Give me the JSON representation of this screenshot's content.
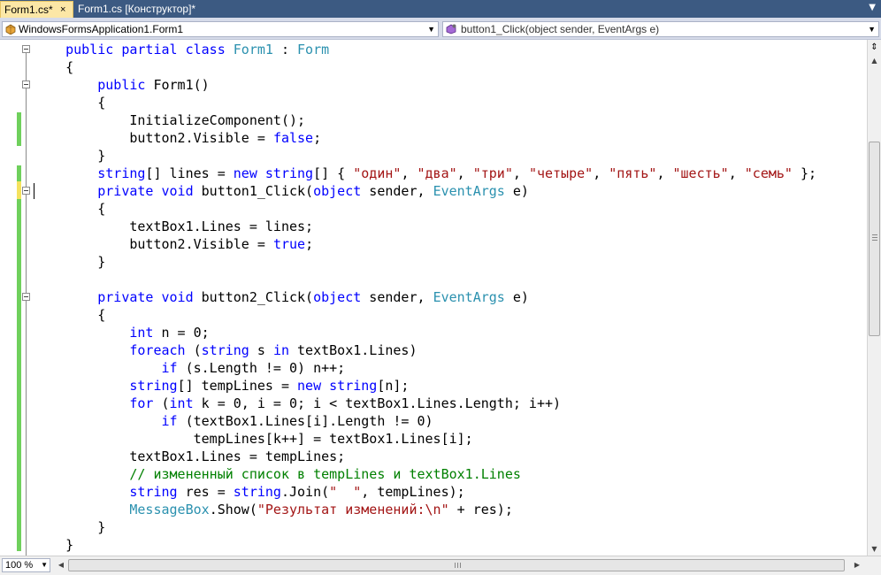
{
  "tabs": [
    {
      "label": "Form1.cs*",
      "active": true
    },
    {
      "label": "Form1.cs [Конструктор]*",
      "active": false
    }
  ],
  "tab_close_glyph": "×",
  "navigation": {
    "class_combo": "WindowsFormsApplication1.Form1",
    "member_combo": "button1_Click(object sender, EventArgs e)"
  },
  "zoom": "100 %",
  "colors": {
    "keyword": "#0000ff",
    "type": "#2b91af",
    "string": "#a31515",
    "comment": "#008000",
    "changed_saved": "#6fd05c",
    "changed_unsaved": "#f5e25e",
    "tabbar_background": "#3c5a82",
    "active_tab": "#fce7a6"
  },
  "code_lines": [
    [
      [
        "",
        "    "
      ],
      [
        "kw",
        "public partial class"
      ],
      [
        "",
        " "
      ],
      [
        "ty",
        "Form1"
      ],
      [
        "",
        " : "
      ],
      [
        "ty",
        "Form"
      ]
    ],
    [
      [
        "",
        "    {"
      ]
    ],
    [
      [
        "",
        "        "
      ],
      [
        "kw",
        "public"
      ],
      [
        "",
        " Form1()"
      ]
    ],
    [
      [
        "",
        "        {"
      ]
    ],
    [
      [
        "",
        "            InitializeComponent();"
      ]
    ],
    [
      [
        "",
        "            button2.Visible = "
      ],
      [
        "kw",
        "false"
      ],
      [
        "",
        ";"
      ]
    ],
    [
      [
        "",
        "        }"
      ]
    ],
    [
      [
        "",
        "        "
      ],
      [
        "kw",
        "string"
      ],
      [
        "",
        "[] lines = "
      ],
      [
        "kw",
        "new"
      ],
      [
        "",
        " "
      ],
      [
        "kw",
        "string"
      ],
      [
        "",
        "[] { "
      ],
      [
        "st",
        "\"один\""
      ],
      [
        "",
        ", "
      ],
      [
        "st",
        "\"два\""
      ],
      [
        "",
        ", "
      ],
      [
        "st",
        "\"три\""
      ],
      [
        "",
        ", "
      ],
      [
        "st",
        "\"четыре\""
      ],
      [
        "",
        ", "
      ],
      [
        "st",
        "\"пять\""
      ],
      [
        "",
        ", "
      ],
      [
        "st",
        "\"шесть\""
      ],
      [
        "",
        ", "
      ],
      [
        "st",
        "\"семь\""
      ],
      [
        "",
        " };"
      ]
    ],
    [
      [
        "",
        "        "
      ],
      [
        "kw",
        "private void"
      ],
      [
        "",
        " button1_Click("
      ],
      [
        "kw",
        "object"
      ],
      [
        "",
        " sender, "
      ],
      [
        "ty",
        "EventArgs"
      ],
      [
        "",
        " e)"
      ]
    ],
    [
      [
        "",
        "        {"
      ]
    ],
    [
      [
        "",
        "            textBox1.Lines = lines;"
      ]
    ],
    [
      [
        "",
        "            button2.Visible = "
      ],
      [
        "kw",
        "true"
      ],
      [
        "",
        ";"
      ]
    ],
    [
      [
        "",
        "        }"
      ]
    ],
    [
      [
        "",
        ""
      ]
    ],
    [
      [
        "",
        "        "
      ],
      [
        "kw",
        "private void"
      ],
      [
        "",
        " button2_Click("
      ],
      [
        "kw",
        "object"
      ],
      [
        "",
        " sender, "
      ],
      [
        "ty",
        "EventArgs"
      ],
      [
        "",
        " e)"
      ]
    ],
    [
      [
        "",
        "        {"
      ]
    ],
    [
      [
        "",
        "            "
      ],
      [
        "kw",
        "int"
      ],
      [
        "",
        " n = 0;"
      ]
    ],
    [
      [
        "",
        "            "
      ],
      [
        "kw",
        "foreach"
      ],
      [
        "",
        " ("
      ],
      [
        "kw",
        "string"
      ],
      [
        "",
        " s "
      ],
      [
        "kw",
        "in"
      ],
      [
        "",
        " textBox1.Lines)"
      ]
    ],
    [
      [
        "",
        "                "
      ],
      [
        "kw",
        "if"
      ],
      [
        "",
        " (s.Length != 0) n++;"
      ]
    ],
    [
      [
        "",
        "            "
      ],
      [
        "kw",
        "string"
      ],
      [
        "",
        "[] tempLines = "
      ],
      [
        "kw",
        "new"
      ],
      [
        "",
        " "
      ],
      [
        "kw",
        "string"
      ],
      [
        "",
        "[n];"
      ]
    ],
    [
      [
        "",
        "            "
      ],
      [
        "kw",
        "for"
      ],
      [
        "",
        " ("
      ],
      [
        "kw",
        "int"
      ],
      [
        "",
        " k = 0, i = 0; i < textBox1.Lines.Length; i++)"
      ]
    ],
    [
      [
        "",
        "                "
      ],
      [
        "kw",
        "if"
      ],
      [
        "",
        " (textBox1.Lines[i].Length != 0)"
      ]
    ],
    [
      [
        "",
        "                    tempLines[k++] = textBox1.Lines[i];"
      ]
    ],
    [
      [
        "",
        "            textBox1.Lines = tempLines;"
      ]
    ],
    [
      [
        "",
        "            "
      ],
      [
        "cm",
        "// измененный список в tempLines и textBox1.Lines"
      ]
    ],
    [
      [
        "",
        "            "
      ],
      [
        "kw",
        "string"
      ],
      [
        "",
        " res = "
      ],
      [
        "kw",
        "string"
      ],
      [
        "",
        ".Join("
      ],
      [
        "st",
        "\"  \""
      ],
      [
        "",
        ", tempLines);"
      ]
    ],
    [
      [
        "",
        "            "
      ],
      [
        "ty",
        "MessageBox"
      ],
      [
        "",
        ".Show("
      ],
      [
        "st",
        "\"Результат изменений:\\n\""
      ],
      [
        "",
        " + res);"
      ]
    ],
    [
      [
        "",
        "        }"
      ]
    ],
    [
      [
        "",
        "    }"
      ]
    ]
  ]
}
